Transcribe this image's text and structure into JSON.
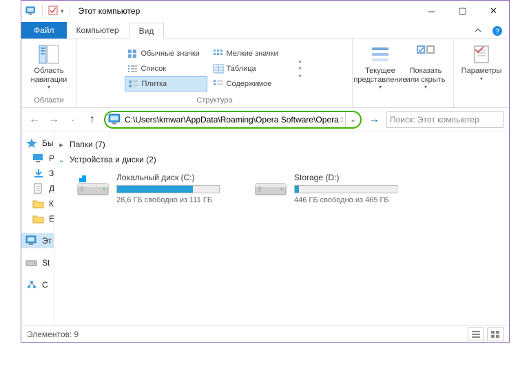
{
  "title": "Этот компьютер",
  "tabs": {
    "file": "Файл",
    "computer": "Компьютер",
    "view": "Вид"
  },
  "ribbon": {
    "nav_area_label": "Область\nнавигации",
    "g_areas": "Области",
    "layout": {
      "regular": "Обычные значки",
      "small": "Мелкие значки",
      "list": "Список",
      "table": "Таблица",
      "tiles": "Плитка",
      "content": "Содержимое"
    },
    "g_layout": "Структура",
    "current_view": "Текущее\nпредставление",
    "show_hide": "Показать\nили скрыть",
    "options": "Параметры"
  },
  "address": "C:\\Users\\kmwar\\AppData\\Roaming\\Opera Software\\Opera Stable",
  "search_placeholder": "Поиск: Этот компьютер",
  "sidebar": {
    "quick": "Бы",
    "desktop": "Р",
    "downloads": "З",
    "docs": "Д",
    "pics": "К",
    "vids": "Е",
    "thispc": "Эт",
    "storage": "St",
    "cont": "С"
  },
  "content": {
    "folders_header": "Папки (7)",
    "drives_header": "Устройства и диски (2)",
    "drives": [
      {
        "name": "Локальный диск (C:)",
        "free": "28,6 ГБ свободно из 111 ГБ",
        "fill_pct": 74
      },
      {
        "name": "Storage (D:)",
        "free": "446 ГБ свободно из 465 ГБ",
        "fill_pct": 4
      }
    ]
  },
  "status": "Элементов: 9"
}
